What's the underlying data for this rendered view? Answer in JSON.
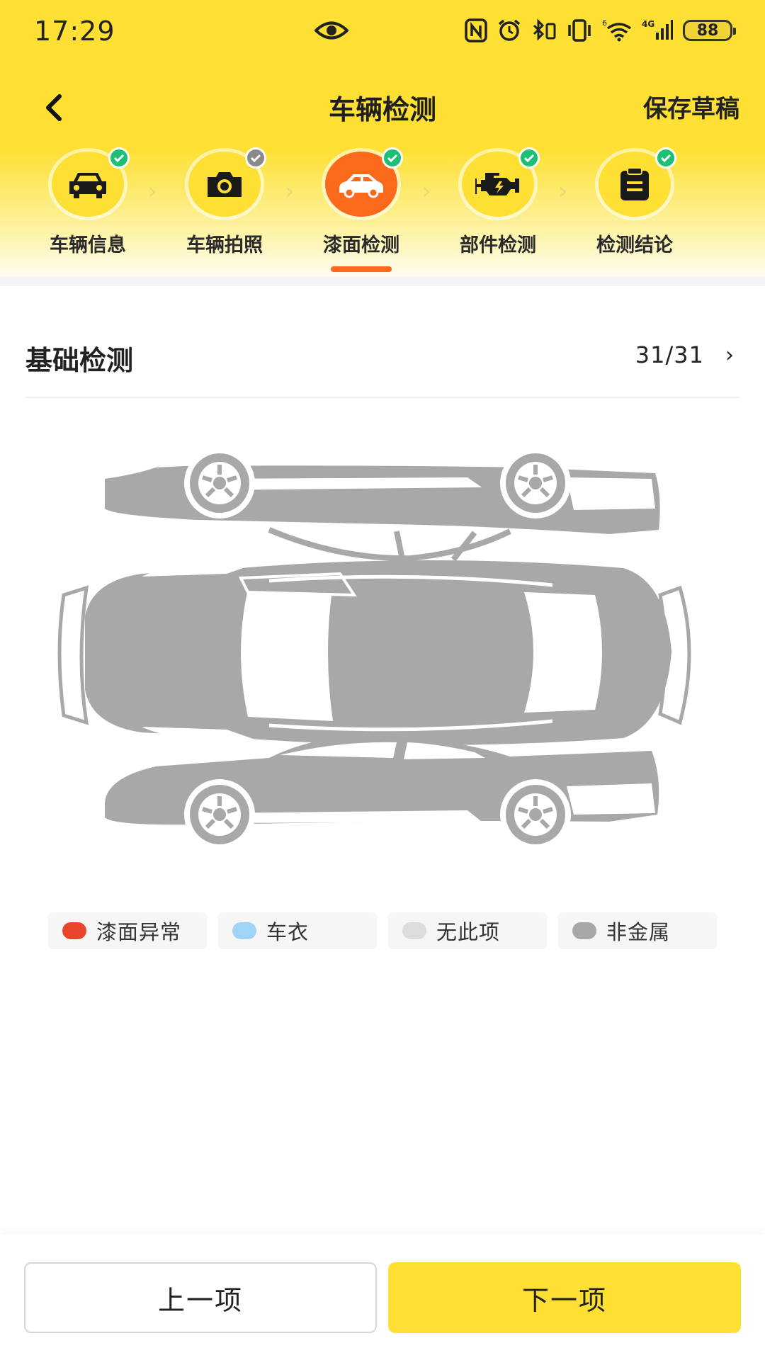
{
  "status_bar": {
    "time": "17:29",
    "battery": "88",
    "network": "4G",
    "icons": [
      "eye-icon",
      "nfc-icon",
      "alarm-icon",
      "bluetooth-icon",
      "vibrate-icon",
      "wifi-icon",
      "signal-icon",
      "battery-icon"
    ]
  },
  "header": {
    "title": "车辆检测",
    "save_label": "保存草稿",
    "back_icon": "chevron-left-icon"
  },
  "steps": [
    {
      "label": "车辆信息",
      "icon": "car-front-icon",
      "status": "done"
    },
    {
      "label": "车辆拍照",
      "icon": "camera-icon",
      "status": "pending"
    },
    {
      "label": "漆面检测",
      "icon": "car-side-icon",
      "status": "done",
      "active": true
    },
    {
      "label": "部件检测",
      "icon": "engine-icon",
      "status": "done"
    },
    {
      "label": "检测结论",
      "icon": "clipboard-icon",
      "status": "done"
    }
  ],
  "section": {
    "title": "基础检测",
    "count": "31/31"
  },
  "legend": [
    {
      "label": "漆面异常",
      "color": "#e8452c"
    },
    {
      "label": "车衣",
      "color": "#9fd4f5"
    },
    {
      "label": "无此项",
      "color": "#dcdcdc"
    },
    {
      "label": "非金属",
      "color": "#a8a8a8"
    }
  ],
  "buttons": {
    "prev": "上一项",
    "next": "下一项"
  },
  "colors": {
    "brand_yellow": "#fde033",
    "accent_orange": "#fa6a1a",
    "check_green": "#1cbf74",
    "car_gray": "#a8a8a8"
  }
}
